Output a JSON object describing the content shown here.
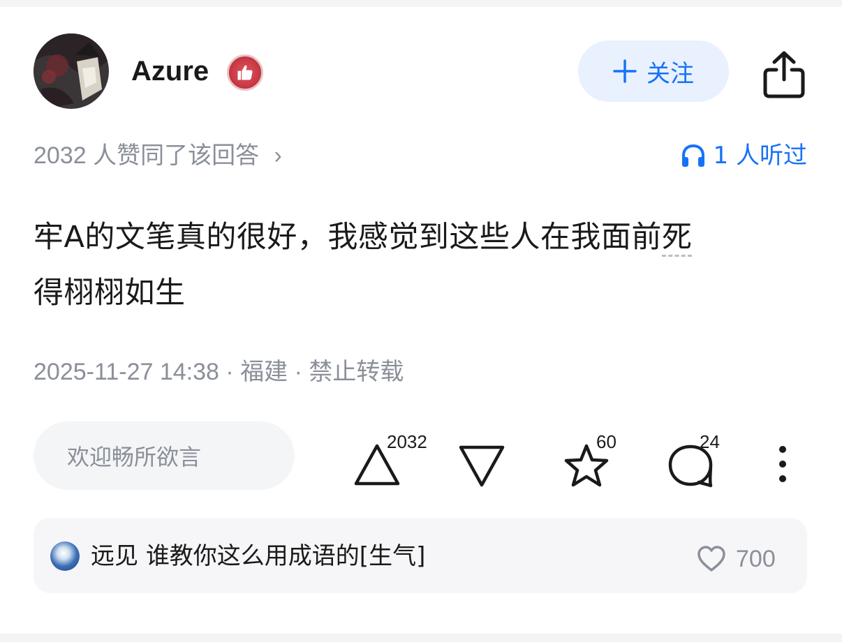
{
  "author": {
    "name": "Azure",
    "badge_icon": "thumbs-up-badge-icon"
  },
  "header": {
    "follow_plus": "+",
    "follow_label": "关注",
    "share_icon": "share-icon"
  },
  "meta": {
    "likes_text": "2032 人赞同了该回答",
    "likes_chevron": "›",
    "listen_text": "1 人听过"
  },
  "answer": {
    "text_main": "牢A的文笔真的很好，我感觉到这些人在我面前",
    "text_underlined": "死",
    "text_line2": "得栩栩如生"
  },
  "post_info": {
    "datetime": "2025-11-27 14:38",
    "separator1": " · ",
    "location": "福建",
    "separator2": " · ",
    "copyright": "禁止转载"
  },
  "actions": {
    "comment_placeholder": "欢迎畅所欲言",
    "upvote_count": "2032",
    "favorite_count": "60",
    "comment_count": "24"
  },
  "hot_comment": {
    "username": "远见",
    "text": "谁教你这么用成语的[生气]",
    "like_count": "700"
  },
  "colors": {
    "accent": "#1772f6",
    "follow_bg": "#e9f1fe",
    "muted_text": "#8a8f99",
    "badge_red": "#c93a45"
  }
}
